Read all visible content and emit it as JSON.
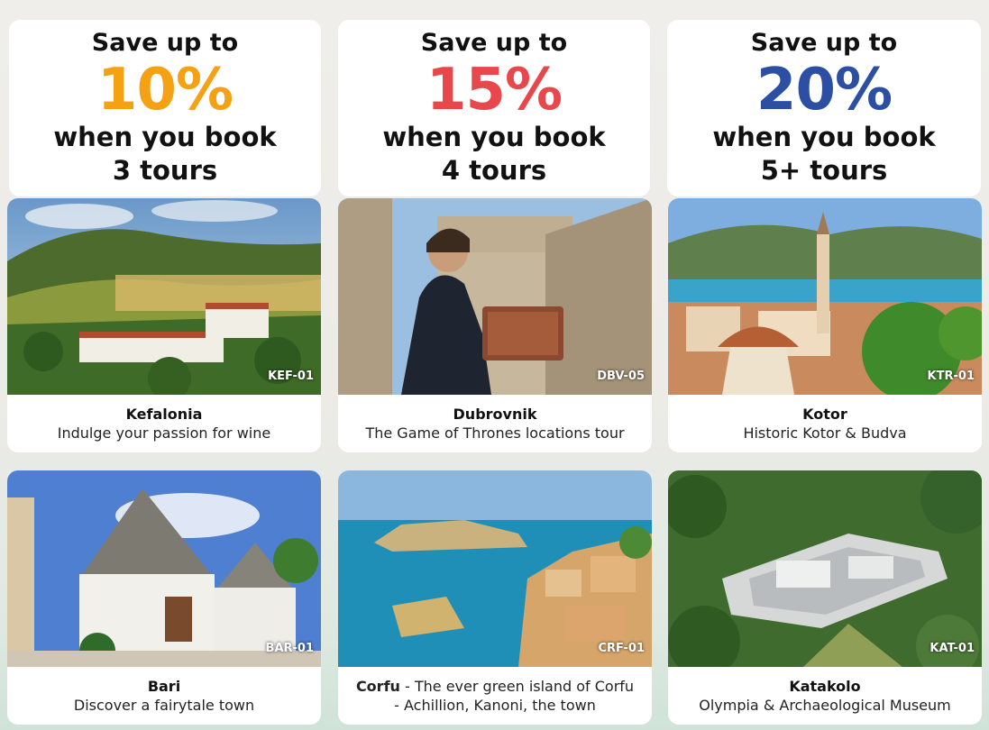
{
  "promos": [
    {
      "save": "Save up to",
      "percent": "10%",
      "line1": "when you book",
      "line2": "3 tours",
      "color": "#f5a114"
    },
    {
      "save": "Save up to",
      "percent": "15%",
      "line1": "when you book",
      "line2": "4 tours",
      "color": "#e8474b"
    },
    {
      "save": "Save up to",
      "percent": "20%",
      "line1": "when you book",
      "line2": "5+ tours",
      "color": "#2c4fa3"
    }
  ],
  "tours": [
    {
      "code": "KEF-01",
      "name": "Kefalonia",
      "description": "Indulge your passion for wine"
    },
    {
      "code": "DBV-05",
      "name": "Dubrovnik",
      "description": "The Game of Thrones locations tour"
    },
    {
      "code": "KTR-01",
      "name": "Kotor",
      "description": "Historic Kotor & Budva"
    },
    {
      "code": "BAR-01",
      "name": "Bari",
      "description": "Discover a fairytale town"
    },
    {
      "code": "CRF-01",
      "name": "Corfu",
      "description_line1": " - The ever green island of Corfu",
      "description_line2": "- Achillion, Kanoni, the town"
    },
    {
      "code": "KAT-01",
      "name": "Katakolo",
      "description": "Olympia & Archaeological Museum"
    }
  ]
}
